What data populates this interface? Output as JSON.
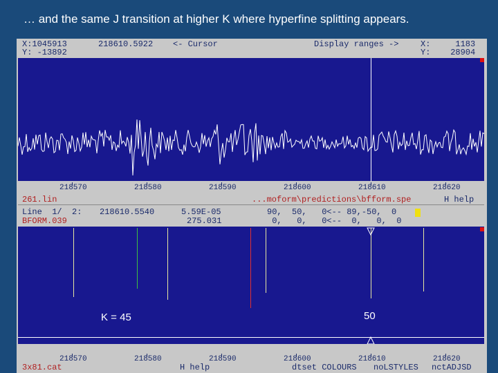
{
  "title": "… and the same J transition at higher K where hyperfine splitting appears.",
  "top_panel": {
    "x_readout": "X:1045913",
    "y_readout": "Y: -13892",
    "cursor_freq": "218610.5922",
    "cursor_label": "<- Cursor",
    "display_ranges_label": "Display ranges ->",
    "range_x": "X:     1183",
    "range_y": "Y:    28904",
    "axis_ticks": [
      "218570",
      "218580",
      "218590",
      "218600",
      "218610",
      "218620"
    ],
    "file_left": "261.lin",
    "file_path": "...moform\\predictions\\bfform.spe",
    "help": "H help"
  },
  "info_panel": {
    "line1_label": "Line  1/  2:",
    "line1_freq": "218610.5540",
    "line1_val": "5.59E-05",
    "line1_qn": "90,  50,   0<-- 89,-50,  0",
    "line2_file": "BFORM.039",
    "line2_val": "275.031",
    "line2_qn": " 0,   0,   0<--  0,   0,  0"
  },
  "bottom_panel": {
    "k45_label": "K = 45",
    "k50_label": "50",
    "axis_ticks": [
      "218570",
      "218580",
      "218590",
      "218600",
      "218610",
      "218620"
    ],
    "file_left": "3x81.cat",
    "help": "H help",
    "cmd1": "dtset COLOURS",
    "cmd2": "noLSTYLES",
    "cmd3": "nctADJSD"
  },
  "colors": {
    "background": "#1a4a7a",
    "panel": "#18188f",
    "window": "#c8c8c8",
    "accent_red": "#e01010",
    "marker_yellow": "#f0e010"
  }
}
